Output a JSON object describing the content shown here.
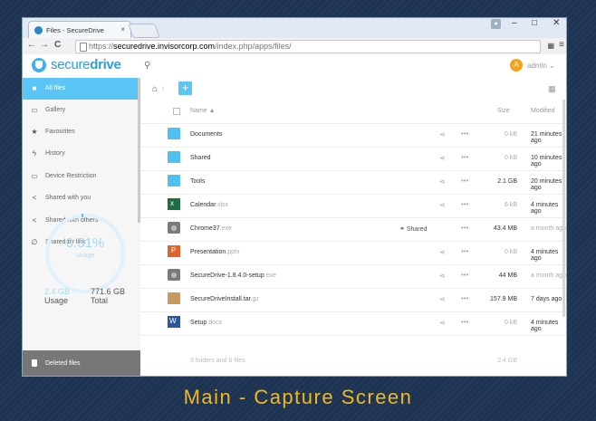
{
  "browser": {
    "tab_title": "Files - SecureDrive",
    "tab_close": "×",
    "win_min": "–",
    "win_max": "□",
    "win_close": "✕",
    "nav_back": "←",
    "nav_fwd": "→",
    "nav_reload": "C",
    "url_scheme": "https://",
    "url_host": "securedrive.invisorcorp.com",
    "url_path": "/index.php/apps/files/"
  },
  "header": {
    "brand_light": "secure",
    "brand_bold": "drive",
    "avatar_letter": "A",
    "user_name": "admin ⌄"
  },
  "sidebar": {
    "items": [
      {
        "label": "All files",
        "icon": "■"
      },
      {
        "label": "Gallery",
        "icon": "▭"
      },
      {
        "label": "Favourites",
        "icon": "★"
      },
      {
        "label": "History",
        "icon": "ϟ"
      },
      {
        "label": "Device Restriction",
        "icon": "▭"
      },
      {
        "label": "Shared with you",
        "icon": "<"
      },
      {
        "label": "Shared with others",
        "icon": "<"
      },
      {
        "label": "Shared by link",
        "icon": "∅"
      }
    ],
    "usage_percent": "0.31%",
    "usage_label": "Usage",
    "used_value": "2.4 GB",
    "used_label": "Usage",
    "total_value": "771.6 GB",
    "total_label": "Total",
    "deleted_label": "Deleted files"
  },
  "main": {
    "col_name": "Name ▲",
    "col_size": "Size",
    "col_modified": "Modified",
    "rows": [
      {
        "name": "Documents",
        "ext": "",
        "type": "folder",
        "size": "0 kB",
        "modified": "21 minutes ago",
        "shared": ""
      },
      {
        "name": "Shared",
        "ext": "",
        "type": "folder",
        "size": "0 kB",
        "modified": "10 minutes ago",
        "shared": ""
      },
      {
        "name": "Tools",
        "ext": "",
        "type": "folder",
        "size": "2.1 GB",
        "modified": "20 minutes ago",
        "shared": ""
      },
      {
        "name": "Calendar",
        "ext": ".xlsx",
        "type": "excel",
        "size": "6 kB",
        "modified": "4 minutes ago",
        "shared": ""
      },
      {
        "name": "Chrome37",
        "ext": ".exe",
        "type": "exe",
        "size": "43.4 MB",
        "modified": "a month ago",
        "shared": "Shared"
      },
      {
        "name": "Presentation",
        "ext": ".pptx",
        "type": "ppt",
        "size": "0 kB",
        "modified": "4 minutes ago",
        "shared": ""
      },
      {
        "name": "SecureDrive-1.8.4.0-setup",
        "ext": ".exe",
        "type": "exe",
        "size": "44 MB",
        "modified": "a month ago",
        "shared": ""
      },
      {
        "name": "SecureDriveInstall.tar",
        "ext": ".gz",
        "type": "tar",
        "size": "157.9 MB",
        "modified": "7 days ago",
        "shared": ""
      },
      {
        "name": "Setup",
        "ext": ".docx",
        "type": "word",
        "size": "0 kB",
        "modified": "4 minutes ago",
        "shared": ""
      }
    ],
    "summary_count": "3 folders and 6 files",
    "summary_size": "2.4 GB"
  },
  "caption": "Main - Capture Screen"
}
